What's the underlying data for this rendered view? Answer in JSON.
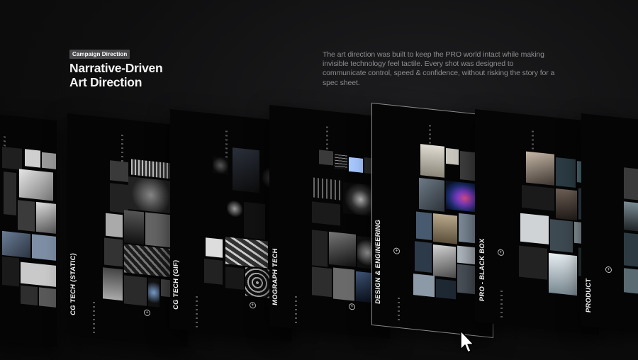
{
  "header": {
    "badge": "Campaign Direction",
    "title_line1": "Narrative-Driven",
    "title_line2": "Art Direction",
    "description": "The art direction was built to keep the PRO world intact while making invisible technology feel tactile. Every shot was designed to communicate control, speed & confidence, without risking the story for a spec sheet."
  },
  "boards": [
    {
      "label": ""
    },
    {
      "label": "CG TECH (STATIC)"
    },
    {
      "label": "CG TECH (GIF)"
    },
    {
      "label": "MOGRAPH TECH"
    },
    {
      "label": "DESIGN & ENGINEERING"
    },
    {
      "label": "PRO - BLACK BOX"
    },
    {
      "label": "PRODUCT"
    }
  ],
  "icons": {
    "board_plus": "+",
    "cursor": "pointer-cursor-icon"
  },
  "colors": {
    "background": "#0d0d0e",
    "badge_bg": "#4a4a4c",
    "description_text": "#8d8d90",
    "accent_pink": "#e8508e",
    "accent_blue": "#3a7bd5"
  }
}
